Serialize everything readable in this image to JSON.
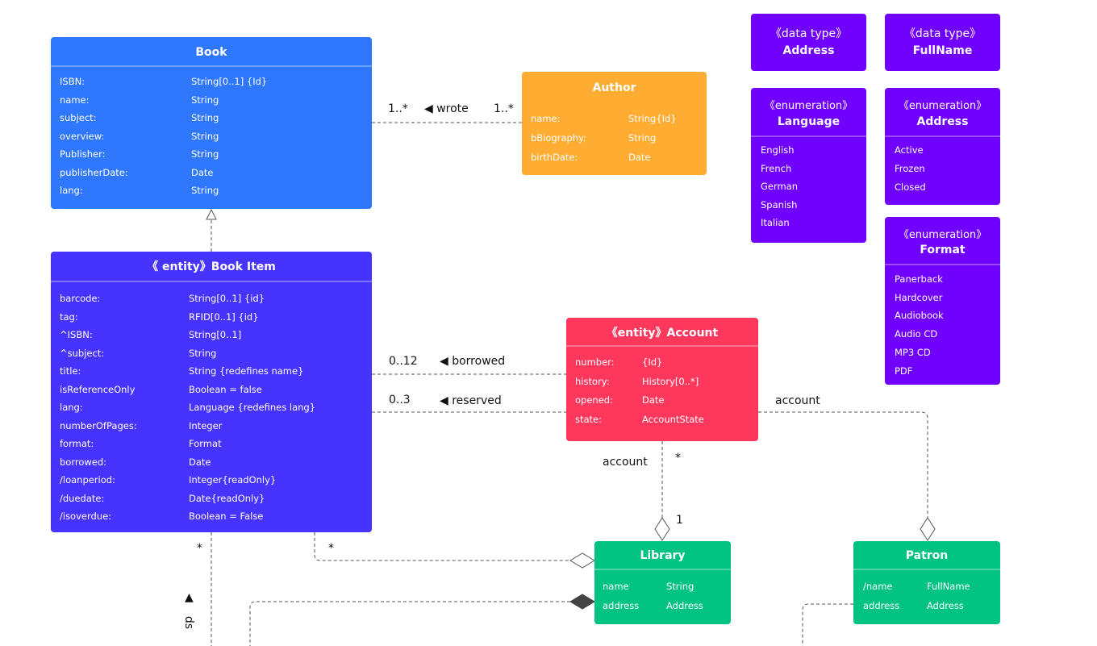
{
  "colors": {
    "book": "#2F77FD",
    "book_item": "#4633FD",
    "author": "#FFAC33",
    "account": "#FE375C",
    "enum": "#7001FD",
    "green": "#00C381"
  },
  "book": {
    "title": "Book",
    "attrs": [
      {
        "n": "ISBN:",
        "t": "String[0..1] {Id}"
      },
      {
        "n": "name:",
        "t": "String"
      },
      {
        "n": "subject:",
        "t": "String"
      },
      {
        "n": "overview:",
        "t": "String"
      },
      {
        "n": "Publisher:",
        "t": "String"
      },
      {
        "n": "publisherDate:",
        "t": "Date"
      },
      {
        "n": "lang:",
        "t": "String"
      }
    ]
  },
  "book_item": {
    "title": "《 entity》Book Item",
    "attrs": [
      {
        "n": "barcode:",
        "t": "String[0..1] {id}"
      },
      {
        "n": "tag:",
        "t": "RFID[0..1] {id}"
      },
      {
        "n": "^ISBN:",
        "t": "String[0..1]"
      },
      {
        "n": "^subject:",
        "t": "String"
      },
      {
        "n": "title:",
        "t": "String {redefines name}"
      },
      {
        "n": "isReferenceOnly",
        "t": "Boolean = false"
      },
      {
        "n": "lang:",
        "t": "Language {redefines lang}"
      },
      {
        "n": "numberOfPages:",
        "t": "Integer"
      },
      {
        "n": "format:",
        "t": "Format"
      },
      {
        "n": "borrowed:",
        "t": "Date"
      },
      {
        "n": "/loanperiod:",
        "t": "Integer{readOnly}"
      },
      {
        "n": "/duedate:",
        "t": "Date{readOnly}"
      },
      {
        "n": "/isoverdue:",
        "t": "Boolean = False"
      }
    ]
  },
  "author": {
    "title": "Author",
    "attrs": [
      {
        "n": "name:",
        "t": "String{Id}"
      },
      {
        "n": "bBiography:",
        "t": "String"
      },
      {
        "n": "birthDate:",
        "t": "Date"
      }
    ]
  },
  "account": {
    "title": "《entity》Account",
    "attrs": [
      {
        "n": "number:",
        "t": "{Id}"
      },
      {
        "n": "history:",
        "t": "History[0..*]"
      },
      {
        "n": "opened:",
        "t": "Date"
      },
      {
        "n": "state:",
        "t": "AccountState"
      }
    ]
  },
  "datatype_address": {
    "stereotype": "《data type》",
    "name": "Address"
  },
  "datatype_fullname": {
    "stereotype": "《data type》",
    "name": "FullName"
  },
  "enum_language": {
    "stereotype": "《enumeration》",
    "name": "Language",
    "items": [
      "English",
      "French",
      "German",
      "Spanish",
      "Italian"
    ]
  },
  "enum_address": {
    "stereotype": "《enumeration》",
    "name": "Address",
    "items": [
      "Active",
      "Frozen",
      "Closed"
    ]
  },
  "enum_format": {
    "stereotype": "《enumeration》",
    "name": "Format",
    "items": [
      "Panerback",
      "Hardcover",
      "Audiobook",
      "Audio CD",
      "MP3 CD",
      "PDF"
    ]
  },
  "library": {
    "title": "Library",
    "attrs": [
      {
        "n": "name",
        "t": "String"
      },
      {
        "n": "address",
        "t": "Address"
      }
    ]
  },
  "patron": {
    "title": "Patron",
    "attrs": [
      {
        "n": "/name",
        "t": "FullName"
      },
      {
        "n": "address",
        "t": "Address"
      }
    ]
  },
  "labels": {
    "wrote_left": "1..*",
    "wrote": "◀ wrote",
    "wrote_right": "1..*",
    "borrowed_mult": "0..12",
    "borrowed": "◀ borrowed",
    "reserved_mult": "0..3",
    "reserved": "◀ reserved",
    "account_left": "account",
    "account_star": "*",
    "account_one": "1",
    "account_right": "account",
    "bookitem_library_star": "*",
    "bookitem_down_star": "*",
    "down_arrow": "▲",
    "down_label": "ds"
  }
}
